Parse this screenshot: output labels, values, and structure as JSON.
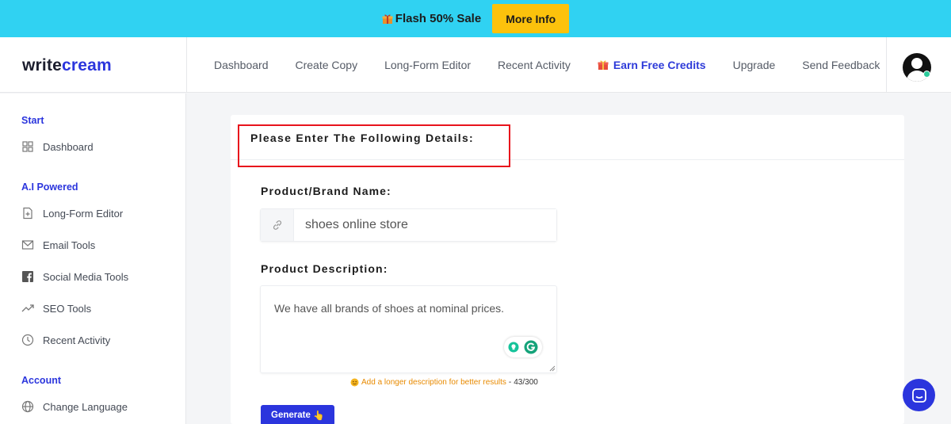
{
  "promo": {
    "text": "Flash 50% Sale",
    "button_label": "More Info"
  },
  "header": {
    "logo_part1": "write",
    "logo_part2": "cream",
    "nav": [
      {
        "label": "Dashboard"
      },
      {
        "label": "Create Copy"
      },
      {
        "label": "Long-Form Editor"
      },
      {
        "label": "Recent Activity"
      },
      {
        "label": "Earn Free Credits",
        "icon": "gift-icon"
      },
      {
        "label": "Upgrade"
      },
      {
        "label": "Send Feedback"
      }
    ]
  },
  "sidebar": {
    "sections": [
      {
        "title": "Start",
        "items": [
          {
            "label": "Dashboard",
            "icon": "grid-icon"
          }
        ]
      },
      {
        "title": "A.I Powered",
        "items": [
          {
            "label": "Long-Form Editor",
            "icon": "document-add-icon"
          },
          {
            "label": "Email Tools",
            "icon": "mail-icon"
          },
          {
            "label": "Social Media Tools",
            "icon": "facebook-icon"
          },
          {
            "label": "SEO Tools",
            "icon": "trending-icon"
          },
          {
            "label": "Recent Activity",
            "icon": "clock-icon"
          }
        ]
      },
      {
        "title": "Account",
        "items": [
          {
            "label": "Change Language",
            "icon": "globe-icon"
          }
        ]
      }
    ]
  },
  "form": {
    "title": "Please Enter The Following Details:",
    "brand_label": "Product/Brand Name:",
    "brand_value": "shoes online store",
    "description_label": "Product Description:",
    "description_value": "We have all brands of shoes at nominal prices.",
    "hint_text": "Add a longer description for better results",
    "hint_separator": " - ",
    "counter": "43/300",
    "generate_label": "Generate"
  },
  "colors": {
    "promo_bg": "#30d2f2",
    "promo_button": "#fcc20c",
    "brand_blue": "#2b35dd",
    "highlight_red": "#e8141c",
    "hint_orange": "#e88a00"
  }
}
